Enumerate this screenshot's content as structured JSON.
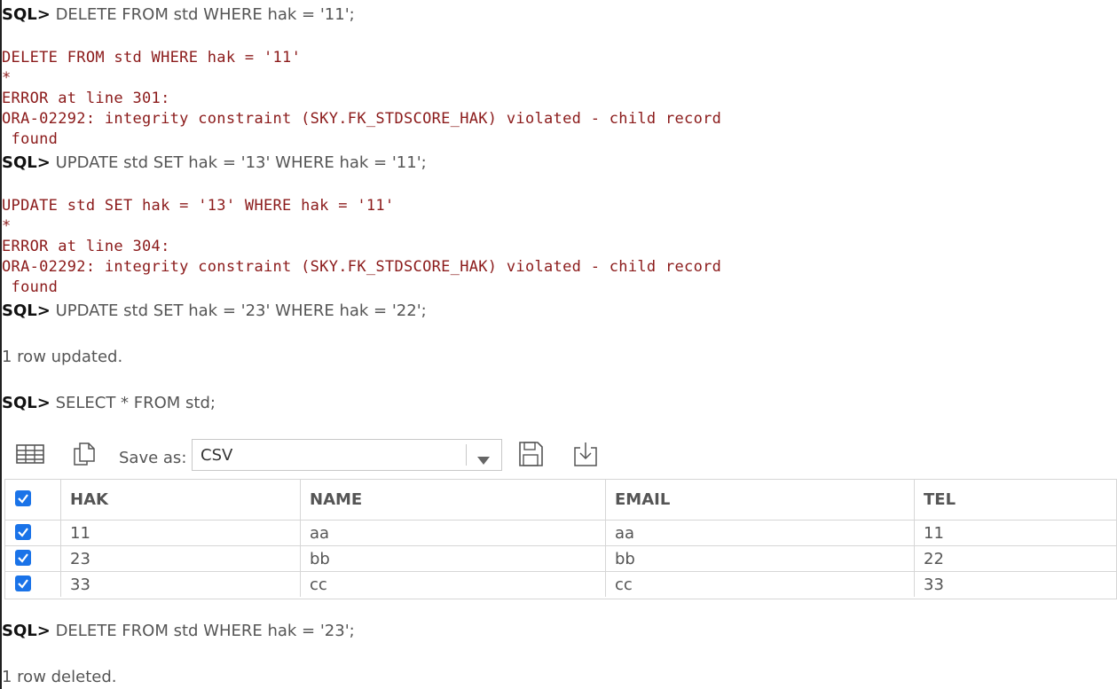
{
  "log": {
    "prompt_label": "SQL>",
    "cmd1": "DELETE FROM std WHERE hak = '11';",
    "err1_echo": "DELETE FROM std WHERE hak = '11'",
    "err1_star": "*",
    "err1_line": "ERROR at line 301:",
    "err1_msg": "ORA-02292: integrity constraint (SKY.FK_STDSCORE_HAK) violated - child record",
    "err1_tail": " found",
    "cmd2": "UPDATE std SET hak = '13' WHERE hak = '11';",
    "err2_echo": "UPDATE std SET hak = '13' WHERE hak = '11'",
    "err2_star": "*",
    "err2_line": "ERROR at line 304:",
    "err2_msg": "ORA-02292: integrity constraint (SKY.FK_STDSCORE_HAK) violated - child record",
    "err2_tail": " found",
    "cmd3": "UPDATE std SET hak = '23' WHERE hak = '22';",
    "info3": "1 row updated.",
    "cmd4": "SELECT * FROM std;",
    "cmd5": "DELETE FROM std WHERE hak = '23';",
    "info5": "1 row deleted."
  },
  "toolbar": {
    "save_as_label": "Save as:",
    "format_value": "CSV",
    "icons": [
      "grid-view-icon",
      "copy-icon",
      "chevron-down-icon",
      "save-icon",
      "download-icon"
    ]
  },
  "table": {
    "columns": [
      "HAK",
      "NAME",
      "EMAIL",
      "TEL"
    ],
    "rows": [
      [
        "11",
        "aa",
        "aa",
        "11"
      ],
      [
        "23",
        "bb",
        "bb",
        "22"
      ],
      [
        "33",
        "cc",
        "cc",
        "33"
      ]
    ],
    "all_checked": true,
    "checkbox_color": "#1a73e8"
  },
  "colors": {
    "error_text": "#8b1a1a",
    "normal_text": "#555555",
    "prompt_text": "#111111"
  }
}
